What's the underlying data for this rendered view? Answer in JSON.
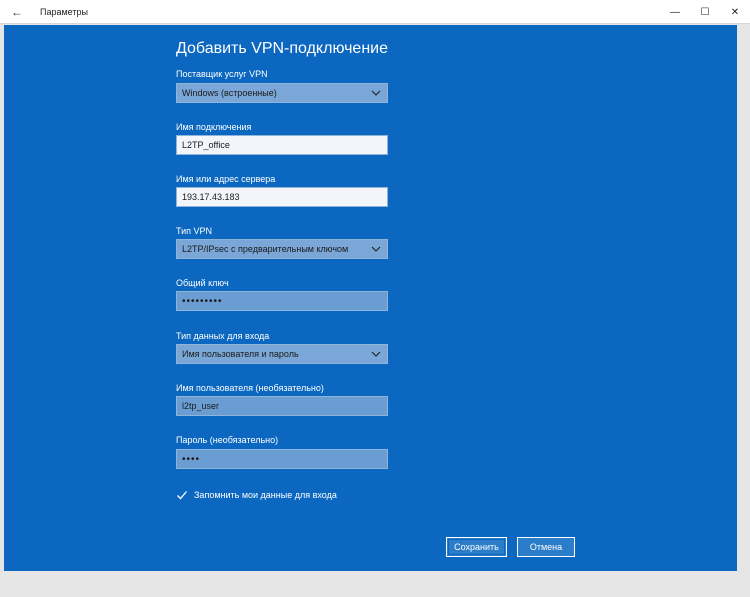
{
  "window": {
    "back_icon": "←",
    "app_title": "Параметры",
    "minimize": "—",
    "maximize": "☐",
    "close": "✕"
  },
  "dialog": {
    "title": "Добавить VPN-подключение",
    "provider": {
      "label": "Поставщик услуг VPN",
      "value": "Windows (встроенные)"
    },
    "connection_name": {
      "label": "Имя подключения",
      "value": "L2TP_office"
    },
    "server": {
      "label": "Имя или адрес сервера",
      "value": "193.17.43.183"
    },
    "vpn_type": {
      "label": "Тип VPN",
      "value": "L2TP/IPsec с предварительным ключом"
    },
    "preshared_key": {
      "label": "Общий ключ",
      "value": "•••••••••"
    },
    "signin_type": {
      "label": "Тип данных для входа",
      "value": "Имя пользователя и пароль"
    },
    "username": {
      "label": "Имя пользователя (необязательно)",
      "value": "l2tp_user"
    },
    "password": {
      "label": "Пароль (необязательно)",
      "value": "••••"
    },
    "remember": {
      "label": "Запомнить мои данные для входа",
      "checked": true
    },
    "save_label": "Сохранить",
    "cancel_label": "Отмена"
  },
  "colors": {
    "dialog_bg": "#0b67c0",
    "select_bg": "#7aa7d7",
    "input_bg": "#f2f6fb"
  },
  "icons": {
    "chevron": "⌄",
    "check": "✓"
  }
}
